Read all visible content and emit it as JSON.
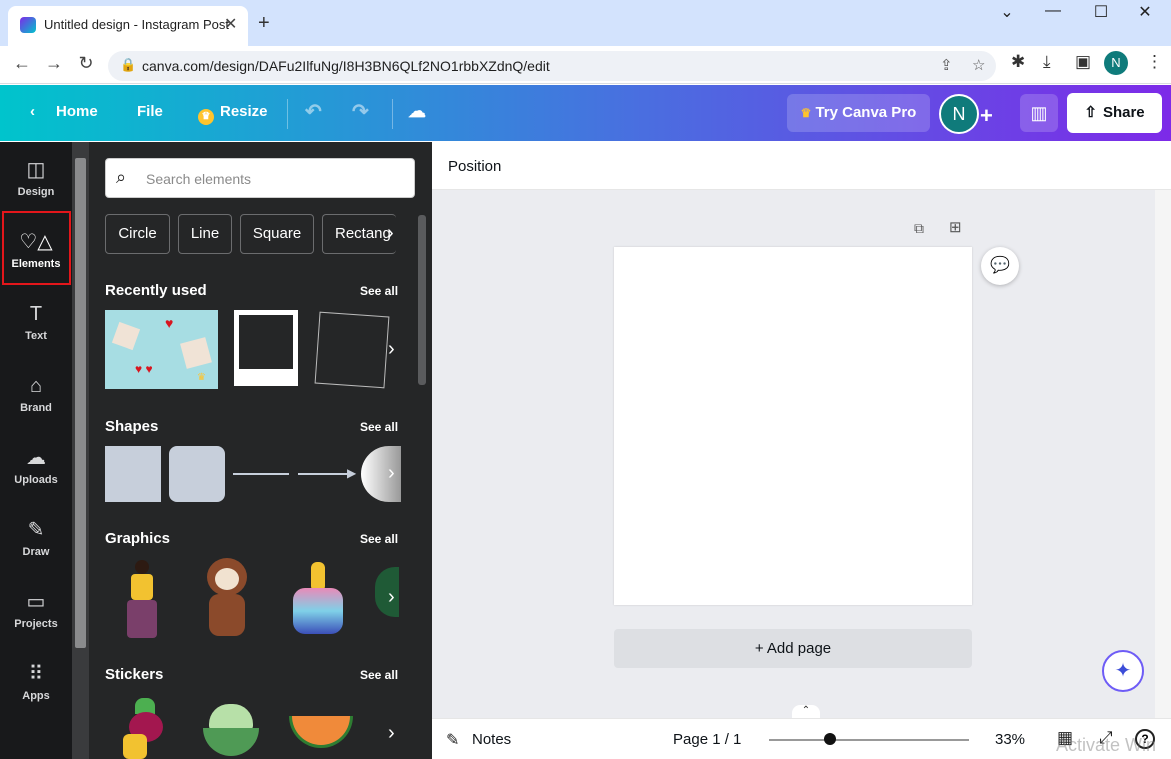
{
  "browser": {
    "tab_title": "Untitled design - Instagram Post",
    "tab_close": "✕",
    "new_tab": "+",
    "url": "canva.com/design/DAFu2IlfuNg/I8H3BN6QLf2NO1rbbXZdnQ/edit",
    "profile_initial": "N",
    "window_controls": {
      "minimize": "—",
      "restore": "☐",
      "close": "✕"
    },
    "icons": [
      "back-arrow-icon",
      "forward-arrow-icon",
      "reload-icon",
      "lock-icon",
      "share-icon",
      "star-icon",
      "puzzle-icon",
      "download-icon",
      "sidepanel-icon"
    ]
  },
  "header": {
    "home": "Home",
    "file": "File",
    "resize": "Resize",
    "try_pro": "Try Canva Pro",
    "avatar_initial": "N",
    "share": "Share",
    "colors": {
      "gradient_start": "#00c4cc",
      "gradient_end": "#7d2ae8",
      "crown": "#ffc42d"
    }
  },
  "sidebar": {
    "items": [
      {
        "label": "Design",
        "icon": "layout-icon"
      },
      {
        "label": "Elements",
        "icon": "shapes-icon"
      },
      {
        "label": "Text",
        "icon": "text-icon"
      },
      {
        "label": "Brand",
        "icon": "brand-icon"
      },
      {
        "label": "Uploads",
        "icon": "cloud-upload-icon"
      },
      {
        "label": "Draw",
        "icon": "pen-icon"
      },
      {
        "label": "Projects",
        "icon": "folder-icon"
      },
      {
        "label": "Apps",
        "icon": "grid-icon"
      }
    ],
    "selected": "Elements",
    "highlight_color": "#e3161b"
  },
  "panel": {
    "search_placeholder": "Search elements",
    "chips": [
      "Circle",
      "Line",
      "Square",
      "Rectang"
    ],
    "sections": {
      "recently_used": "Recently used",
      "shapes": "Shapes",
      "graphics": "Graphics",
      "stickers": "Stickers"
    },
    "see_all": "See all"
  },
  "editor": {
    "position": "Position",
    "add_page": "+ Add page",
    "notes": "Notes",
    "page_indicator": "Page 1 / 1",
    "zoom": "33%",
    "help": "?",
    "watermark": "Activate Win"
  }
}
